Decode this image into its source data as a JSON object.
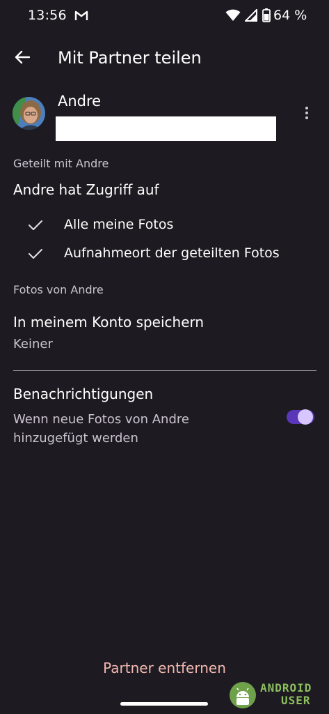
{
  "status_bar": {
    "time": "13:56",
    "battery": "64 %",
    "icons": [
      "gmail-icon",
      "wifi-icon",
      "signal-icon",
      "battery-icon"
    ]
  },
  "header": {
    "title": "Mit Partner teilen",
    "back_icon": "arrow-back-icon"
  },
  "partner": {
    "name": "Andre",
    "menu_icon": "more-vert-icon"
  },
  "shared_with": {
    "label": "Geteilt mit Andre",
    "access_heading": "Andre hat Zugriff auf",
    "items": [
      {
        "label": "Alle meine Fotos",
        "icon": "check-icon"
      },
      {
        "label": "Aufnahmeort der geteilten Fotos",
        "icon": "check-icon"
      }
    ]
  },
  "photos_from": {
    "label": "Fotos von Andre",
    "save_title": "In meinem Konto speichern",
    "save_value": "Keiner"
  },
  "notifications": {
    "title": "Benachrichtigungen",
    "description": "Wenn neue Fotos von Andre hinzugefügt werden",
    "enabled": true
  },
  "remove_partner": "Partner entfernen",
  "watermark": {
    "line1": "ANDROID",
    "line2": "USER"
  },
  "colors": {
    "background": "#1d1b21",
    "toggle_track": "#5a37b8",
    "toggle_thumb": "#d7c6ff",
    "danger_text": "#f2b8b0"
  }
}
